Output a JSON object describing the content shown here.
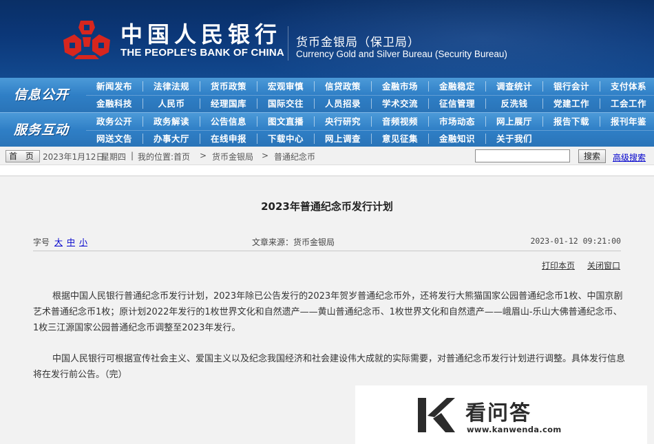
{
  "header": {
    "brand_cn": "中国人民银行",
    "brand_en": "THE PEOPLE'S BANK OF CHINA",
    "bureau_cn": "货币金银局（保卫局）",
    "bureau_en": "Currency  Gold and Silver Bureau (Security Bureau)",
    "logo_icon": "pboc-logo-icon",
    "colors": {
      "header_bg": "#0b3778",
      "logo_red": "#d7261e",
      "nav_bg": "#2f7fc6"
    }
  },
  "nav": {
    "sections": [
      {
        "title": "信息公开",
        "rows": [
          [
            "新闻发布",
            "法律法规",
            "货币政策",
            "宏观审慎",
            "信贷政策",
            "金融市场",
            "金融稳定",
            "调查统计",
            "银行会计",
            "支付体系"
          ],
          [
            "金融科技",
            "人民币",
            "经理国库",
            "国际交往",
            "人员招录",
            "学术交流",
            "征信管理",
            "反洗钱",
            "党建工作",
            "工会工作"
          ]
        ]
      },
      {
        "title": "服务互动",
        "rows": [
          [
            "政务公开",
            "政务解读",
            "公告信息",
            "图文直播",
            "央行研究",
            "音频视频",
            "市场动态",
            "网上展厅",
            "报告下载",
            "报刊年鉴"
          ],
          [
            "网送文告",
            "办事大厅",
            "在线申报",
            "下载中心",
            "网上调查",
            "意见征集",
            "金融知识",
            "关于我们"
          ]
        ]
      }
    ]
  },
  "crumbbar": {
    "home_label": "首 页",
    "date": "2023年1月12日",
    "weekday": "星期四",
    "sep": "|",
    "location_label": "我的位置:首页",
    "arrow": ">",
    "crumb1": "货币金银局",
    "crumb2": "普通纪念币",
    "search_value": "",
    "search_button": "搜索",
    "advanced_search": "高级搜索"
  },
  "article": {
    "title": "2023年普通纪念币发行计划",
    "font_size_label": "字号",
    "font_large": "大",
    "font_medium": "中",
    "font_small": "小",
    "source": "文章来源：货币金银局",
    "datetime": "2023-01-12  09:21:00",
    "print_link": "打印本页",
    "close_link": "关闭窗口",
    "paragraph1": "根据中国人民银行普通纪念币发行计划，2023年除已公告发行的2023年贺岁普通纪念币外，还将发行大熊猫国家公园普通纪念币1枚、中国京剧艺术普通纪念币1枚；原计划2022年发行的1枚世界文化和自然遗产——黄山普通纪念币、1枚世界文化和自然遗产——峨眉山-乐山大佛普通纪念币、1枚三江源国家公园普通纪念币调整至2023年发行。",
    "paragraph2": "中国人民银行可根据宣传社会主义、爱国主义以及纪念我国经济和社会建设伟大成就的实际需要，对普通纪念币发行计划进行调整。具体发行信息将在发行前公告。（完）"
  },
  "watermark": {
    "logo_icon": "kanwenda-logo-icon",
    "name_cn": "看问答",
    "url": "www.kanwenda.com"
  }
}
